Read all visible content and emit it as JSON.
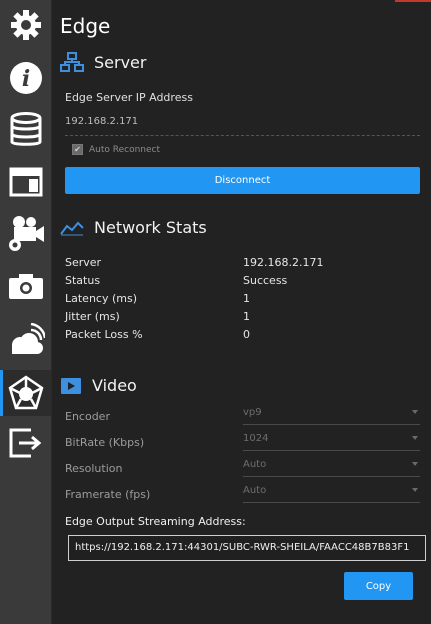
{
  "sidebar": {
    "icons": [
      "gear-icon",
      "info-icon",
      "database-icon",
      "layout-icon",
      "camera-settings-icon",
      "camera-icon",
      "cloud-stream-icon",
      "edge-network-icon",
      "exit-icon"
    ],
    "active": "edge-network-icon"
  },
  "page": {
    "title": "Edge"
  },
  "server": {
    "header": "Server",
    "ip_label": "Edge Server IP Address",
    "ip_value": "192.168.2.171",
    "auto_reconnect_label": "Auto Reconnect",
    "auto_reconnect_checked": true,
    "disconnect_label": "Disconnect"
  },
  "network": {
    "header": "Network Stats",
    "rows": [
      {
        "key": "Server",
        "value": "192.168.2.171"
      },
      {
        "key": "Status",
        "value": "Success"
      },
      {
        "key": "Latency (ms)",
        "value": "1"
      },
      {
        "key": "Jitter (ms)",
        "value": "1"
      },
      {
        "key": "Packet Loss %",
        "value": "0"
      }
    ]
  },
  "video": {
    "header": "Video",
    "encoder_label": "Encoder",
    "encoder_value": "vp9",
    "bitrate_label": "BitRate (Kbps)",
    "bitrate_value": "1024",
    "resolution_label": "Resolution",
    "resolution_value": "Auto",
    "framerate_label": "Framerate (fps)",
    "framerate_value": "Auto",
    "output_label": "Edge Output Streaming Address:",
    "output_value": "https://192.168.2.171:44301/SUBC-RWR-SHEILA/FAACC48B7B83F1",
    "copy_label": "Copy"
  },
  "colors": {
    "accent": "#2196f3",
    "background": "#222222",
    "sidebar": "#3a3a3a"
  }
}
